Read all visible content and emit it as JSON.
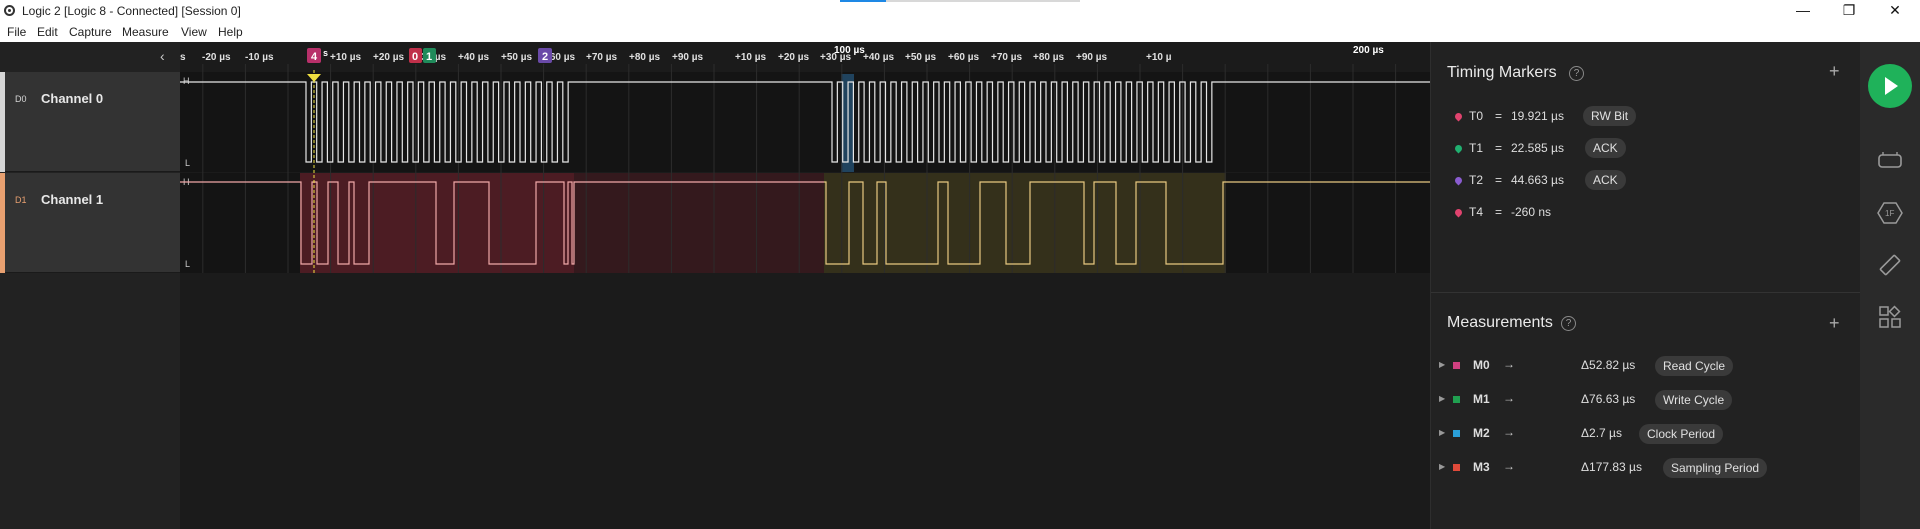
{
  "window": {
    "title": "Logic 2 [Logic 8 - Connected] [Session 0]",
    "minimize": "—",
    "maximize": "❐",
    "close": "✕"
  },
  "menu": [
    "File",
    "Edit",
    "Capture",
    "Measure",
    "View",
    "Help"
  ],
  "channels": [
    {
      "id": "D0",
      "name": "Channel 0",
      "color": "#d6d6d6"
    },
    {
      "id": "D1",
      "name": "Channel 1",
      "color": "#e8a070"
    }
  ],
  "timeline": {
    "ticks": [
      "s",
      "-20 µs",
      "-10 µs",
      "+10 µs",
      "+20 µs",
      "+30 µs",
      "+40 µs",
      "+50 µs",
      "+60 µs",
      "+70 µs",
      "+80 µs",
      "+90 µs",
      "+10 µs",
      "+20 µs",
      "+30 µs",
      "+40 µs",
      "+50 µs",
      "+60 µs",
      "+70 µs",
      "+80 µs",
      "+90 µs",
      "+10 µ"
    ],
    "major_labels": [
      "100 µs",
      "200 µs"
    ],
    "zero_suffix": "s",
    "level_high": "H",
    "level_low": "L"
  },
  "timing_markers": {
    "title": "Timing Markers",
    "help": "?",
    "add": "+",
    "items": [
      {
        "name": "T0",
        "eq": "=",
        "value": "19.921 µs",
        "tag": "RW Bit",
        "color": "#e0436e"
      },
      {
        "name": "T1",
        "eq": "=",
        "value": "22.585 µs",
        "tag": "ACK",
        "color": "#20b070"
      },
      {
        "name": "T2",
        "eq": "=",
        "value": "44.663 µs",
        "tag": "ACK",
        "color": "#8a5cd0"
      },
      {
        "name": "T4",
        "eq": "=",
        "value": "-260 ns",
        "tag": "",
        "color": "#e0436e"
      }
    ]
  },
  "flags": [
    {
      "label": "4",
      "color": "#b8306a"
    },
    {
      "label": "0",
      "color": "#c0304a"
    },
    {
      "label": "1",
      "color": "#1f8a5a"
    },
    {
      "label": "2",
      "color": "#6a4aa8"
    }
  ],
  "measurements": {
    "title": "Measurements",
    "help": "?",
    "add": "+",
    "items": [
      {
        "name": "M0",
        "arrow": "→",
        "value": "Δ52.82 µs",
        "tag": "Read Cycle",
        "color": "#d04080"
      },
      {
        "name": "M1",
        "arrow": "→",
        "value": "Δ76.63 µs",
        "tag": "Write Cycle",
        "color": "#20a050"
      },
      {
        "name": "M2",
        "arrow": "→",
        "value": "Δ2.7 µs",
        "tag": "Clock Period",
        "color": "#2a9fd8"
      },
      {
        "name": "M3",
        "arrow": "→",
        "value": "Δ177.83 µs",
        "tag": "Sampling Period",
        "color": "#e04a3a"
      }
    ]
  },
  "toolbar": {
    "collapse": "‹",
    "tools": [
      "capture-settings-icon",
      "analyzers-icon",
      "measure-ruler-icon",
      "extensions-icon"
    ]
  }
}
